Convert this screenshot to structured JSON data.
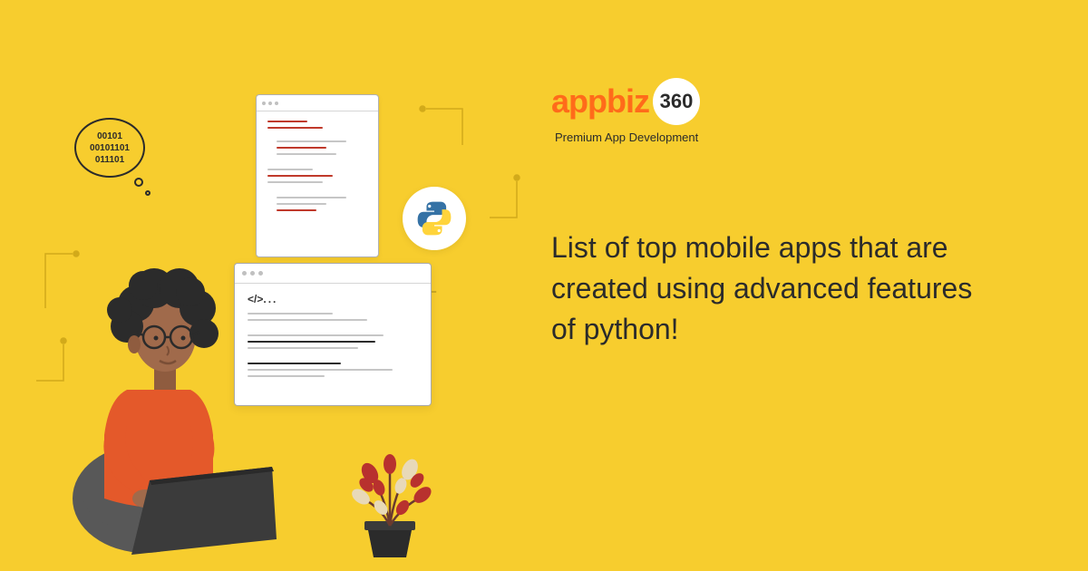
{
  "logo": {
    "brand_part1": "app",
    "brand_part2": "biz",
    "brand_number": "360",
    "tagline": "Premium App Development"
  },
  "headline": "List of top mobile apps that are created using advanced features of python!",
  "illustration": {
    "binary_line1": "00101",
    "binary_line2": "00101101",
    "binary_line3": "011101",
    "code_symbol": "</>",
    "code_ellipsis": "..."
  },
  "colors": {
    "background": "#f7cd2e",
    "accent_orange": "#ff6b1a",
    "text_dark": "#2b2b2b",
    "shirt": "#e4592a",
    "skin": "#a06a4b",
    "hair": "#2b2b2b",
    "laptop": "#3b3b3b",
    "chair": "#585858",
    "python_blue": "#3572A5",
    "python_yellow": "#FFD43B",
    "plant_red": "#b8312e",
    "plant_cream": "#e8d9b8"
  }
}
